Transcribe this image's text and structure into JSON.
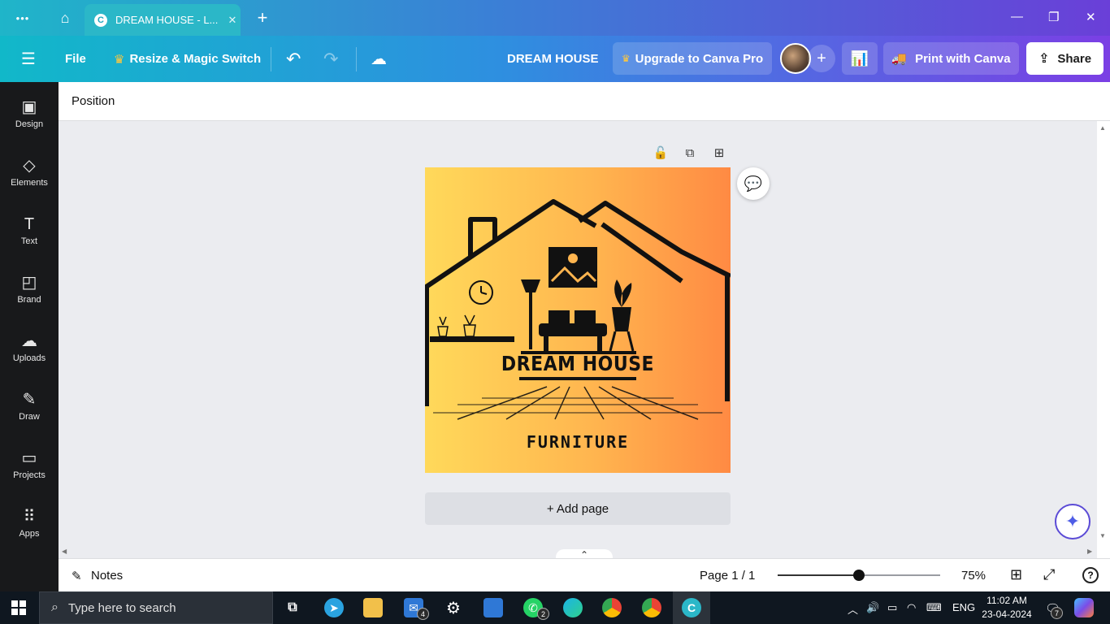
{
  "browser": {
    "tab_title": "DREAM HOUSE - L...",
    "tab_logo": "C",
    "close_tab": "✕",
    "new_tab": "+",
    "menu_dots": "•••",
    "home_icon": "⌂",
    "window_controls": {
      "minimize": "—",
      "maximize": "❐",
      "close": "✕"
    }
  },
  "toolbar": {
    "menu_icon": "☰",
    "file_label": "File",
    "resize_label": "Resize & Magic Switch",
    "undo_icon": "↶",
    "redo_icon": "↷",
    "cloud_icon": "☁",
    "doc_title": "DREAM HOUSE",
    "upgrade_label": "Upgrade to Canva Pro",
    "add_collab": "+",
    "analytics_icon": "📊",
    "print_label": "Print with Canva",
    "share_label": "Share",
    "crown_icon": "♛"
  },
  "sidebar": {
    "items": [
      {
        "label": "Design",
        "icon": "▣"
      },
      {
        "label": "Elements",
        "icon": "◇"
      },
      {
        "label": "Text",
        "icon": "T"
      },
      {
        "label": "Brand",
        "icon": "◰"
      },
      {
        "label": "Uploads",
        "icon": "☁"
      },
      {
        "label": "Draw",
        "icon": "✎"
      },
      {
        "label": "Projects",
        "icon": "▭"
      },
      {
        "label": "Apps",
        "icon": "⠿"
      }
    ]
  },
  "context": {
    "position_label": "Position"
  },
  "canvas": {
    "page_tools": {
      "lock": "🔓",
      "duplicate": "⧉",
      "add": "⊞"
    },
    "design_title": "DREAM HOUSE",
    "design_subtitle": "FURNITURE",
    "comment_icon": "💬",
    "add_page_label": "+ Add page",
    "magic_icon": "✦",
    "collapse_icon": "⌃"
  },
  "footer": {
    "notes_label": "Notes",
    "notes_icon": "✎",
    "page_indicator": "Page 1 / 1",
    "zoom": 75,
    "zoom_label": "75%",
    "grid_icon": "⊞",
    "fullscreen_icon": "⤢",
    "help_icon": "?"
  },
  "taskbar": {
    "search_placeholder": "Type here to search",
    "search_icon": "⌕",
    "badges": {
      "mail": "4",
      "whatsapp": "2",
      "notifications": "7"
    },
    "language": "ENG",
    "time": "11:02 AM",
    "date": "23-04-2024"
  }
}
